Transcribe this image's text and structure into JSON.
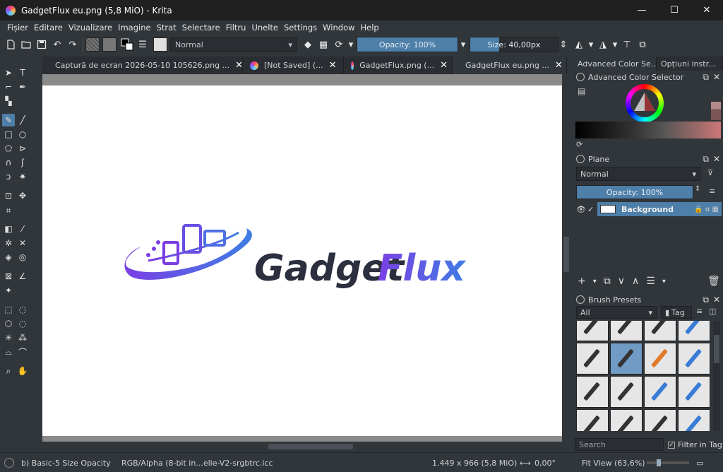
{
  "window": {
    "title": "GadgetFlux eu.png (5,8 MiO)  - Krita",
    "minimize": "—",
    "maximize": "☐",
    "close": "✕"
  },
  "menu": [
    {
      "label": "Fișier"
    },
    {
      "label": "Editare"
    },
    {
      "label": "Vizualizare"
    },
    {
      "label": "Imagine"
    },
    {
      "label": "Strat"
    },
    {
      "label": "Selectare"
    },
    {
      "label": "Filtru"
    },
    {
      "label": "Unelte"
    },
    {
      "label": "Settings"
    },
    {
      "label": "Window"
    },
    {
      "label": "Help"
    }
  ],
  "toolbar": {
    "blend_mode": "Normal",
    "opacity_label": "Opacity: 100%",
    "opacity_value": 1.0,
    "size_label": "Size: 40,00px",
    "size_fill": 0.33
  },
  "doc_tabs": [
    {
      "label": "Captură de ecran 2026-05-10 105626.png ...",
      "active": false
    },
    {
      "label": "[Not Saved]  (...",
      "active": false
    },
    {
      "label": "GadgetFlux.png (...",
      "active": false
    },
    {
      "label": "GadgetFlux eu.png ...",
      "active": true
    }
  ],
  "canvas": {
    "logo_text_1": "Gadget",
    "logo_text_2": "Flux",
    "colors": {
      "dark": "#2b2f3e",
      "purple": "#7b3fe4",
      "blue": "#3f7de4"
    }
  },
  "docker": {
    "tabs": [
      "Advanced Color Se...",
      "Opțiuni instr..."
    ],
    "color_selector_title": "Advanced Color Selector",
    "layers_title": "Plane",
    "layers_blend": "Normal",
    "layers_opacity": "Opacity: 100%",
    "layer_name": "Background",
    "brush_title": "Brush Presets",
    "brush_filter": "All",
    "brush_tag": "Tag",
    "brush_search": "Search",
    "filter_in_tag": "Filter in Tag"
  },
  "status": {
    "brush": "b) Basic-5 Size Opacity",
    "color_space": "RGB/Alpha (8-bit in...elle-V2-srgbtrc.icc",
    "dimensions": "1.449 x 966 (5,8 MiO)",
    "rotation": "0,00°",
    "zoom": "Fit View (63,6%)"
  },
  "accent": "#4d7fa8"
}
